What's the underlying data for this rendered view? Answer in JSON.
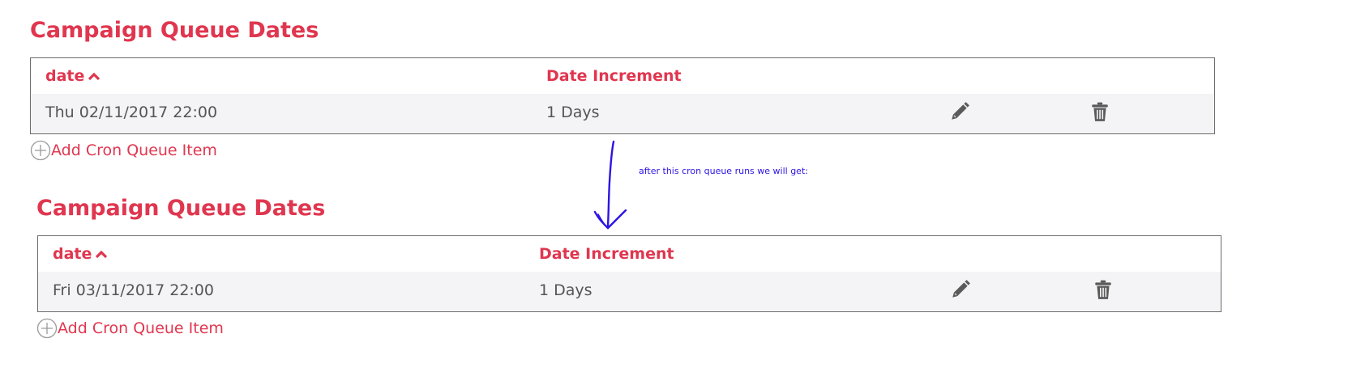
{
  "colors": {
    "accent": "#e0364f",
    "text": "#555555",
    "row_bg": "#f4f4f6",
    "border": "#6b6b6b",
    "annotation_ink": "#2d14e6"
  },
  "sections": [
    {
      "title": "Campaign Queue Dates",
      "columns": {
        "date": "date",
        "increment": "Date Increment"
      },
      "row": {
        "date": "Thu 02/11/2017 22:00",
        "increment": "1 Days"
      },
      "add_label": "Add Cron Queue Item"
    },
    {
      "title": "Campaign Queue Dates",
      "columns": {
        "date": "date",
        "increment": "Date Increment"
      },
      "row": {
        "date": "Fri 03/11/2017 22:00",
        "increment": "1 Days"
      },
      "add_label": "Add Cron Queue Item"
    }
  ],
  "annotation": {
    "text": "after this cron queue runs we will get:"
  },
  "icons": {
    "sort": "chevron-up-icon",
    "edit": "pencil-icon",
    "delete": "trash-icon",
    "add": "plus-circle-icon",
    "arrow": "hand-drawn-down-arrow"
  }
}
